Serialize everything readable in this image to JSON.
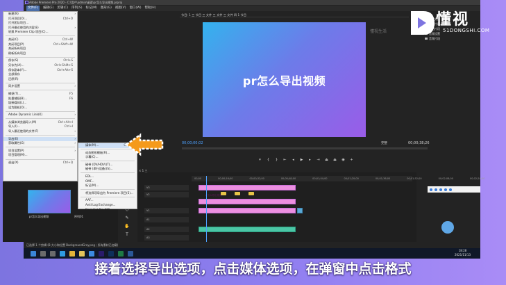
{
  "window": {
    "title": "Adobe Premiere Pro 2020 - C:\\用户\\admin\\桌面\\pr怎么导出视频.prproj"
  },
  "menubar": [
    "文件(F)",
    "编辑(E)",
    "剪辑(C)",
    "序列(S)",
    "标记(M)",
    "图形(G)",
    "视图(V)",
    "窗口(W)",
    "帮助(H)"
  ],
  "file_menu": {
    "items": [
      {
        "label": "新建(N)",
        "shortcut": "",
        "arrow": true
      },
      {
        "label": "打开项目(O)...",
        "shortcut": "Ctrl+O"
      },
      {
        "label": "打开团队项目...",
        "shortcut": ""
      },
      {
        "label": "打开最近使用的内容(E)",
        "shortcut": "",
        "arrow": true
      },
      {
        "label": "转换 Premiere Clip 项目(C)...",
        "shortcut": ""
      },
      {
        "label": "关闭(C)",
        "shortcut": "Ctrl+W"
      },
      {
        "label": "关闭项目(P)",
        "shortcut": "Ctrl+Shift+W"
      },
      {
        "label": "关闭所有项目",
        "shortcut": ""
      },
      {
        "label": "刷新所有项目",
        "shortcut": ""
      },
      {
        "label": "保存(S)",
        "shortcut": "Ctrl+S"
      },
      {
        "label": "另存为(A)...",
        "shortcut": "Ctrl+Shift+S"
      },
      {
        "label": "保存副本(Y)...",
        "shortcut": "Ctrl+Alt+S"
      },
      {
        "label": "全部保存",
        "shortcut": ""
      },
      {
        "label": "还原(R)",
        "shortcut": ""
      },
      {
        "label": "同步设置",
        "shortcut": "",
        "arrow": true
      },
      {
        "label": "捕捉(T)...",
        "shortcut": "F5"
      },
      {
        "label": "批量捕捉(B)...",
        "shortcut": "F6"
      },
      {
        "label": "链接媒体(L)...",
        "shortcut": ""
      },
      {
        "label": "设为脱机(O)...",
        "shortcut": ""
      },
      {
        "label": "Adobe Dynamic Link(K)",
        "shortcut": "",
        "arrow": true
      },
      {
        "label": "从媒体浏览器导入(M)",
        "shortcut": "Ctrl+Alt+I"
      },
      {
        "label": "导入(I)...",
        "shortcut": "Ctrl+I"
      },
      {
        "label": "导入最近使用的文件(F)",
        "shortcut": "",
        "arrow": true
      },
      {
        "label": "导出(E)",
        "shortcut": "",
        "arrow": true,
        "highlight": true
      },
      {
        "label": "获取属性(G)",
        "shortcut": "",
        "arrow": true
      },
      {
        "label": "项目设置(P)",
        "shortcut": "",
        "arrow": true
      },
      {
        "label": "项目管理(M)...",
        "shortcut": ""
      },
      {
        "label": "退出(X)",
        "shortcut": "Ctrl+Q"
      }
    ]
  },
  "export_submenu": {
    "items": [
      {
        "label": "媒体(M)...",
        "shortcut": "Ctrl+M",
        "highlight": true
      },
      {
        "label": "动态图形模板(R)...",
        "shortcut": ""
      },
      {
        "label": "字幕(C)...",
        "shortcut": ""
      },
      {
        "label": "磁带 (DV/HDV)(T)...",
        "shortcut": ""
      },
      {
        "label": "磁带 (串行设备)(S)...",
        "shortcut": ""
      },
      {
        "label": "EDL...",
        "shortcut": ""
      },
      {
        "label": "OMF...",
        "shortcut": ""
      },
      {
        "label": "标记(M)...",
        "shortcut": ""
      },
      {
        "label": "将选择项导出为 Premiere 项目(S)...",
        "shortcut": ""
      },
      {
        "label": "AAF...",
        "shortcut": ""
      },
      {
        "label": "Avid Log Exchange...",
        "shortcut": ""
      },
      {
        "label": "Final Cut Pro XML...",
        "shortcut": ""
      }
    ]
  },
  "program_monitor": {
    "tab": "节目: 1 三 节目 三 文件 三 文件 三 文件 四 1 节目",
    "preview_title": "pr怎么导出视频",
    "timecode_current": "00;00;00;02",
    "timecode_total": "00;00;38;26",
    "fit": "完整"
  },
  "project_panel": {
    "items": [
      "项目文件",
      "音频片段",
      "项目片段",
      "音频设置",
      "音频片段"
    ]
  },
  "media_panel": {
    "clip_label": "pr怎么导出视频",
    "sequence_label": "序列01"
  },
  "timeline": {
    "tab": "× 1 三",
    "ruler_ticks": [
      "00;00",
      "00;00;16;00",
      "00;00;32;00",
      "00;00;48;00",
      "00;01;04;00",
      "00;01;20;00",
      "00;01;36;00",
      "00;01;52;00",
      "00;02;08;00",
      "00;02;24;00"
    ],
    "tracks": [
      "V3",
      "V2",
      "V1",
      "A1",
      "A2",
      "A3"
    ],
    "clip_title": "pr怎么导出视频"
  },
  "status": {
    "text": "已选择 1 个剪辑 (B 大小和位置 BackgroundGrey.png ; 所有素材已加载)"
  },
  "taskbar": {
    "time": "18:28",
    "date": "2021/11/13"
  },
  "watermark": {
    "brand": "懂视",
    "domain": "51DONGSHI.COM",
    "faint": "懂视生活"
  },
  "caption": {
    "text": "接着选择导出选项，点击媒体选项，在弹窗中点击格式"
  },
  "colors": {
    "accent": "#4ea2ff",
    "arrow": "#f59a1b",
    "clip_pink": "#ec8fe0",
    "clip_teal": "#4bc6a6"
  }
}
